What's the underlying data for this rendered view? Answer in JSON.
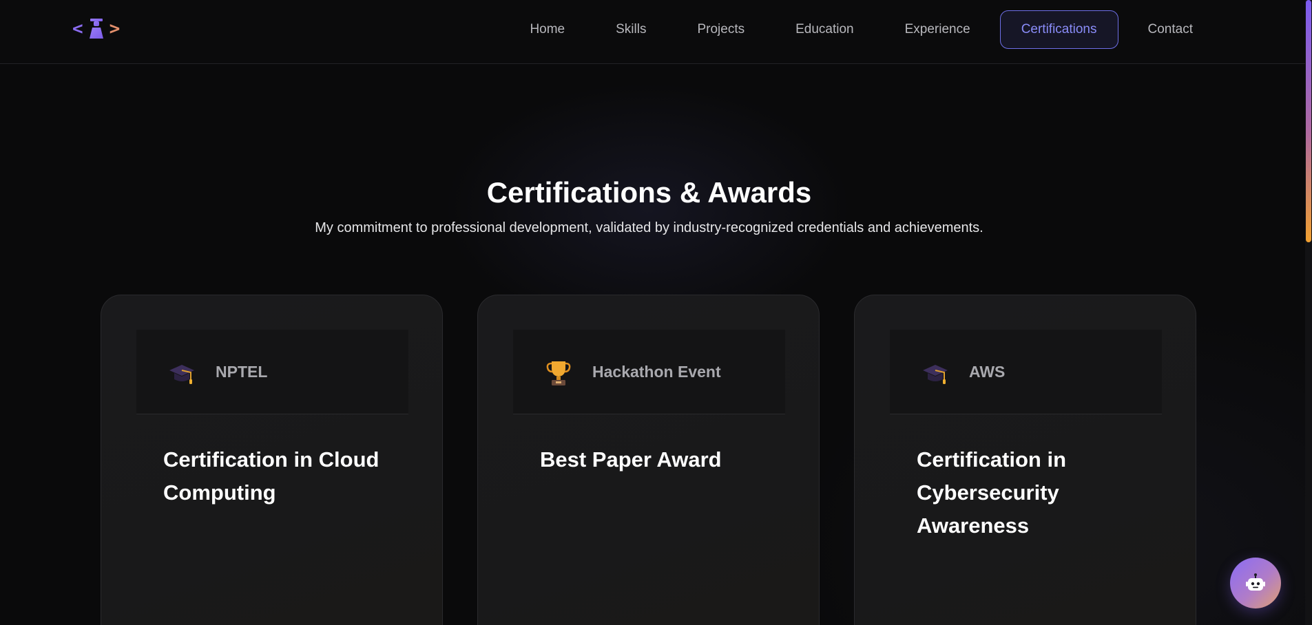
{
  "nav": {
    "logo": {
      "left_bracket": "<",
      "right_bracket": ">",
      "icon": "graduate-figure-icon"
    },
    "links": [
      {
        "label": "Home"
      },
      {
        "label": "Skills"
      },
      {
        "label": "Projects"
      },
      {
        "label": "Education"
      },
      {
        "label": "Experience"
      },
      {
        "label": "Certifications",
        "active": true
      },
      {
        "label": "Contact"
      }
    ]
  },
  "section": {
    "title": "Certifications & Awards",
    "subtitle": "My commitment to professional development, validated by industry-recognized credentials and achievements."
  },
  "cards": [
    {
      "issuer": "NPTEL",
      "icon": "graduation-cap-icon",
      "title": "Certification in Cloud Computing"
    },
    {
      "issuer": "Hackathon Event",
      "icon": "trophy-icon",
      "title": "Best Paper Award"
    },
    {
      "issuer": "AWS",
      "icon": "graduation-cap-icon",
      "title": "Certification in Cybersecurity Awareness"
    }
  ],
  "chatbot": {
    "icon": "robot-icon"
  },
  "colors": {
    "background": "#0a0a0b",
    "accent": "#6e6fe8",
    "accent_text": "#8a8cf8",
    "card_bg": "#1a1a1c",
    "scroll_gradient_top": "#7b5cf0",
    "scroll_gradient_bottom": "#f0a030"
  }
}
